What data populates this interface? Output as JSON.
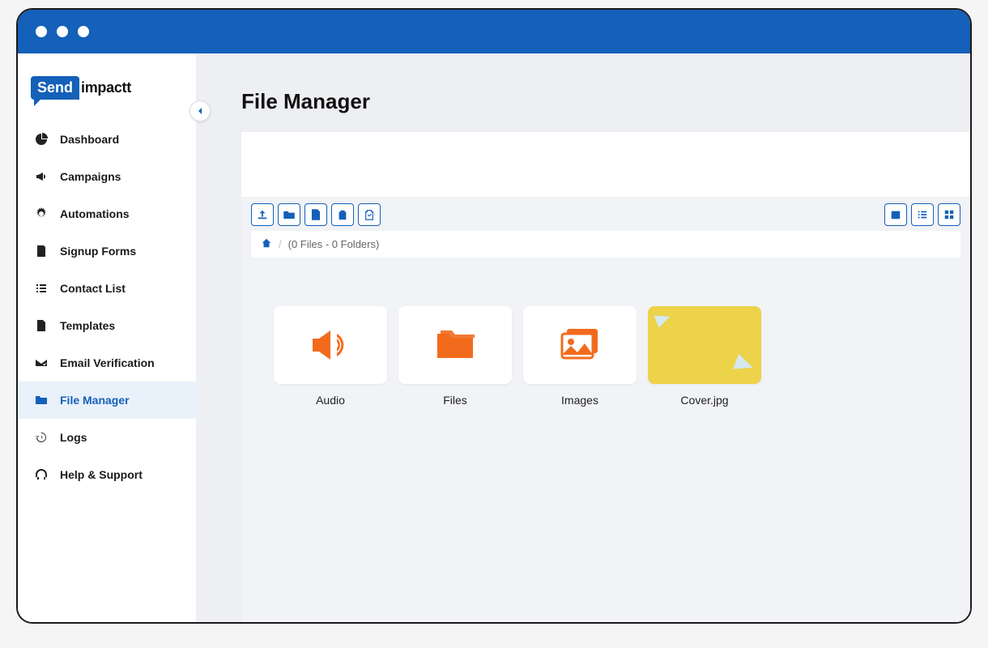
{
  "brand": {
    "badge": "Send",
    "rest": "impactt"
  },
  "sidebar": {
    "items": [
      {
        "label": "Dashboard",
        "icon": "pie"
      },
      {
        "label": "Campaigns",
        "icon": "megaphone"
      },
      {
        "label": "Automations",
        "icon": "gears"
      },
      {
        "label": "Signup Forms",
        "icon": "form"
      },
      {
        "label": "Contact List",
        "icon": "list"
      },
      {
        "label": "Templates",
        "icon": "doc"
      },
      {
        "label": "Email Verification",
        "icon": "mailcheck"
      },
      {
        "label": "File Manager",
        "icon": "folder",
        "active": true
      },
      {
        "label": "Logs",
        "icon": "history"
      },
      {
        "label": "Help & Support",
        "icon": "support"
      }
    ]
  },
  "page": {
    "title": "File Manager"
  },
  "toolbar": {
    "left": [
      "upload",
      "newfolder",
      "addfile",
      "paste",
      "clipboard"
    ],
    "right": [
      "calendar",
      "listview",
      "gridview"
    ]
  },
  "breadcrumb": {
    "summary": "(0 Files - 0 Folders)"
  },
  "files": [
    {
      "label": "Audio",
      "type": "audio"
    },
    {
      "label": "Files",
      "type": "folder"
    },
    {
      "label": "Images",
      "type": "images"
    },
    {
      "label": "Cover.jpg",
      "type": "cover"
    }
  ],
  "colors": {
    "accent": "#1560b8",
    "fileIcon": "#f26b1d"
  }
}
